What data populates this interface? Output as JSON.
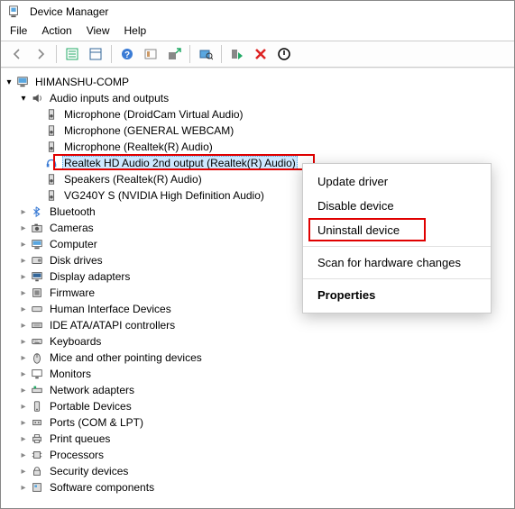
{
  "window": {
    "title": "Device Manager"
  },
  "menubar": [
    "File",
    "Action",
    "View",
    "Help"
  ],
  "tree": {
    "root": "HIMANSHU-COMP",
    "audio": {
      "label": "Audio inputs and outputs",
      "children": [
        "Microphone (DroidCam Virtual Audio)",
        "Microphone (GENERAL WEBCAM)",
        "Microphone (Realtek(R) Audio)",
        "Realtek HD Audio 2nd output (Realtek(R) Audio)",
        "Speakers (Realtek(R) Audio)",
        "VG240Y S (NVIDIA High Definition Audio)"
      ]
    },
    "categories": [
      "Bluetooth",
      "Cameras",
      "Computer",
      "Disk drives",
      "Display adapters",
      "Firmware",
      "Human Interface Devices",
      "IDE ATA/ATAPI controllers",
      "Keyboards",
      "Mice and other pointing devices",
      "Monitors",
      "Network adapters",
      "Portable Devices",
      "Ports (COM & LPT)",
      "Print queues",
      "Processors",
      "Security devices",
      "Software components"
    ]
  },
  "context_menu": {
    "items": [
      "Update driver",
      "Disable device",
      "Uninstall device",
      "Scan for hardware changes",
      "Properties"
    ]
  }
}
